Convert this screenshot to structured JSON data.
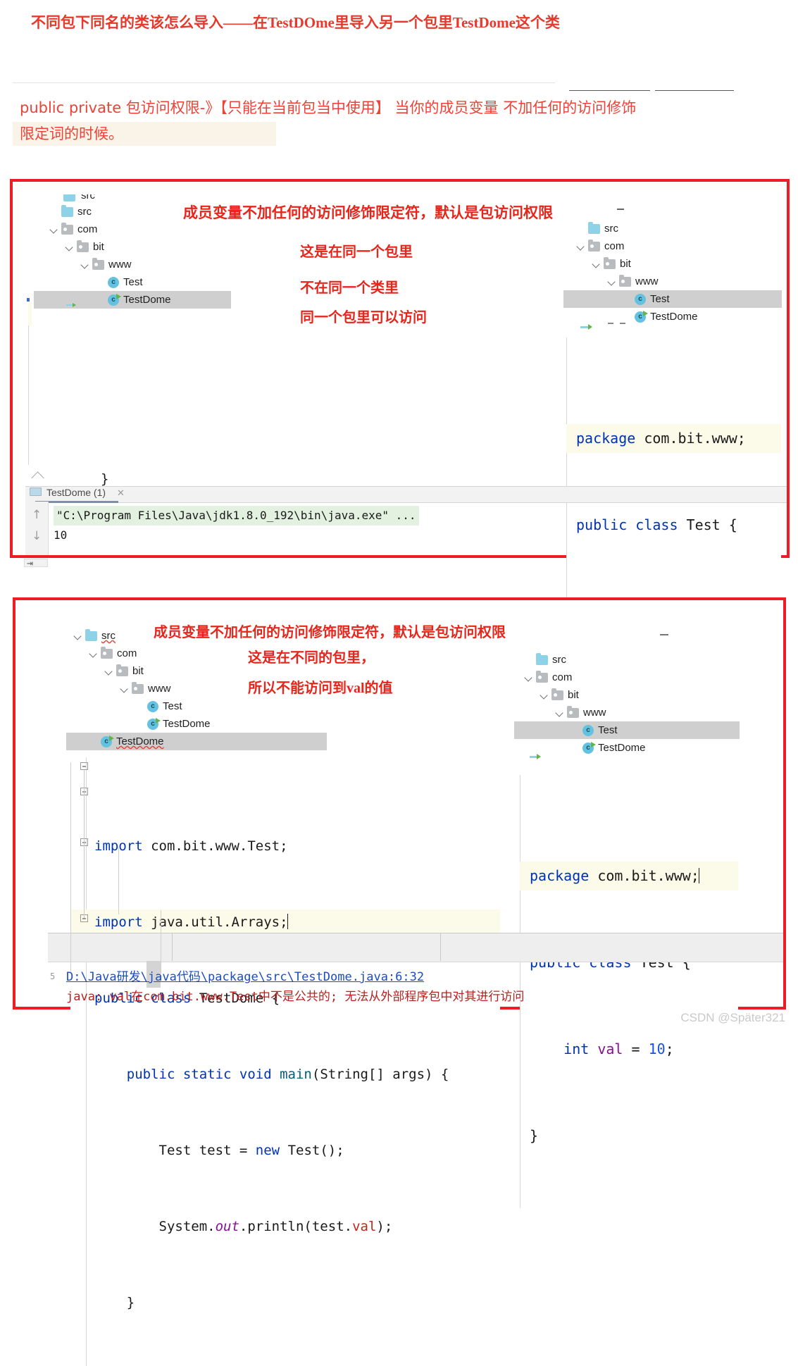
{
  "header": {
    "title": "不同包下同名的类该怎么导入——在TestDOme里导入另一个包里TestDome这个类",
    "paragraph_line1": "public   private  包访问权限-》【只能在当前包当中使用】  当你的成员变量 不加任何的访问修饰",
    "paragraph_line2": "限定词的时候。"
  },
  "box1": {
    "annotations": {
      "title": "成员变量不加任何的访问修饰限定符，默认是包访问权限",
      "line1": "这是在同一个包里",
      "line2": "不在同一个类里",
      "line3": "同一个包里可以访问"
    },
    "left_tree": [
      {
        "label": "src",
        "icon": "folder-src-icon",
        "depth": 1,
        "chevron": false,
        "selected": false,
        "runnable": false
      },
      {
        "label": "com",
        "icon": "folder-package-icon",
        "depth": 1,
        "chevron": true,
        "selected": false,
        "runnable": false
      },
      {
        "label": "bit",
        "icon": "folder-package-icon",
        "depth": 2,
        "chevron": true,
        "selected": false,
        "runnable": false
      },
      {
        "label": "www",
        "icon": "folder-package-icon",
        "depth": 3,
        "chevron": true,
        "selected": false,
        "runnable": false
      },
      {
        "label": "Test",
        "icon": "java-class-icon",
        "depth": 4,
        "chevron": false,
        "selected": false,
        "runnable": false
      },
      {
        "label": "TestDome",
        "icon": "java-class-icon",
        "depth": 4,
        "chevron": false,
        "selected": true,
        "runnable": true
      }
    ],
    "right_tree": [
      {
        "label": "src",
        "icon": "folder-src-icon",
        "depth": 1,
        "chevron": false,
        "selected": false,
        "runnable": false
      },
      {
        "label": "com",
        "icon": "folder-package-icon",
        "depth": 1,
        "chevron": true,
        "selected": false,
        "runnable": false
      },
      {
        "label": "bit",
        "icon": "folder-package-icon",
        "depth": 2,
        "chevron": true,
        "selected": false,
        "runnable": false
      },
      {
        "label": "www",
        "icon": "folder-package-icon",
        "depth": 3,
        "chevron": true,
        "selected": false,
        "runnable": false
      },
      {
        "label": "Test",
        "icon": "java-class-icon",
        "depth": 4,
        "chevron": false,
        "selected": true,
        "runnable": false
      },
      {
        "label": "TestDome",
        "icon": "java-class-icon",
        "depth": 4,
        "chevron": false,
        "selected": false,
        "runnable": true
      }
    ],
    "code": {
      "l1_kw": "package",
      "l1_rest": " com.bit.www;",
      "l2_kw": "public class",
      "l2_rest": " Test {",
      "l3_indent": "    ",
      "l3_kw": "int",
      "l3_field": " val",
      "l3_eq": " = ",
      "l3_num": "10",
      "l3_semi": ";",
      "l4": "}"
    },
    "console": {
      "tab_label": "TestDome (1)",
      "tab_close": "✕",
      "line1": "\"C:\\Program Files\\Java\\jdk1.8.0_192\\bin\\java.exe\" ...",
      "line2": "10",
      "arrow_up": "↑",
      "arrow_down": "↓"
    }
  },
  "box2": {
    "annotations": {
      "title": "成员变量不加任何的访问修饰限定符，默认是包访问权限",
      "line1": "这是在不同的包里，",
      "line2": "所以不能访问到val的值"
    },
    "left_tree": [
      {
        "label": "src",
        "icon": "folder-src-icon",
        "depth": 1,
        "chevron": true,
        "selected": false,
        "runnable": false,
        "squiggle": true
      },
      {
        "label": "com",
        "icon": "folder-package-icon",
        "depth": 2,
        "chevron": true,
        "selected": false,
        "runnable": false,
        "squiggle": false
      },
      {
        "label": "bit",
        "icon": "folder-package-icon",
        "depth": 3,
        "chevron": true,
        "selected": false,
        "runnable": false,
        "squiggle": false
      },
      {
        "label": "www",
        "icon": "folder-package-icon",
        "depth": 4,
        "chevron": true,
        "selected": false,
        "runnable": false,
        "squiggle": false
      },
      {
        "label": "Test",
        "icon": "java-class-icon",
        "depth": 5,
        "chevron": false,
        "selected": false,
        "runnable": false,
        "squiggle": false
      },
      {
        "label": "TestDome",
        "icon": "java-class-icon",
        "depth": 5,
        "chevron": false,
        "selected": false,
        "runnable": true,
        "squiggle": false
      },
      {
        "label": "TestDome",
        "icon": "java-class-icon",
        "depth": 2,
        "chevron": false,
        "selected": true,
        "runnable": true,
        "squiggle": true
      }
    ],
    "right_tree": [
      {
        "label": "src",
        "icon": "folder-src-icon",
        "depth": 1,
        "chevron": false,
        "selected": false,
        "runnable": false
      },
      {
        "label": "com",
        "icon": "folder-package-icon",
        "depth": 1,
        "chevron": true,
        "selected": false,
        "runnable": false
      },
      {
        "label": "bit",
        "icon": "folder-package-icon",
        "depth": 2,
        "chevron": true,
        "selected": false,
        "runnable": false
      },
      {
        "label": "www",
        "icon": "folder-package-icon",
        "depth": 3,
        "chevron": true,
        "selected": false,
        "runnable": false
      },
      {
        "label": "Test",
        "icon": "java-class-icon",
        "depth": 4,
        "chevron": false,
        "selected": true,
        "runnable": false
      },
      {
        "label": "TestDome",
        "icon": "java-class-icon",
        "depth": 4,
        "chevron": false,
        "selected": false,
        "runnable": true
      }
    ],
    "left_code": {
      "l1_kw": "import",
      "l1_rest": " com.bit.www.Test;",
      "l2_kw": "import",
      "l2_rest": " java.util.Arrays;",
      "l3_kw": "public class",
      "l3_rest": " TestDome {",
      "l4_indent": "    ",
      "l4_kw": "public static void",
      "l4_meth": " main",
      "l4_rest": "(String[] args) {",
      "l5_indent": "        ",
      "l5_a": "Test test = ",
      "l5_kw": "new",
      "l5_b": " Test();",
      "l6_indent": "        ",
      "l6_a": "System.",
      "l6_static": "out",
      "l6_b": ".println(test.",
      "l6_field": "val",
      "l6_c": ");",
      "l7_indent": "    ",
      "l7": "}"
    },
    "right_code": {
      "l1_kw": "package",
      "l1_rest": " com.bit.www;",
      "l2_kw": "public class",
      "l2_rest": " Test {",
      "l3_indent": "    ",
      "l3_kw": "int",
      "l3_field": " val",
      "l3_eq": " = ",
      "l3_num": "10",
      "l3_semi": ";",
      "l4": "}"
    },
    "error_panel": {
      "gutter": "5",
      "link": "D:\\Java研发\\java代码\\package\\src\\TestDome.java:6:32",
      "message": "java: val在com.bit.www.Test中不是公共的; 无法从外部程序包中对其进行访问"
    }
  },
  "watermark": "CSDN @Später321",
  "colors": {
    "red_box": "#ee1c25",
    "annotation_red": "#e8251b",
    "title_red": "#e8382c",
    "paragraph_red": "#ef4136",
    "highlight_cream": "#faf3e8",
    "tree_selection": "#cfcfcf",
    "code_keyword": "#0033b3",
    "code_number": "#1750eb",
    "code_field": "#871094",
    "code_field_red": "#c3261b",
    "code_method": "#00627a",
    "console_highlight": "#e3f2e0",
    "error_link": "#1a4cc4",
    "error_text": "#bb2020",
    "watermark": "#c9c9c9"
  }
}
